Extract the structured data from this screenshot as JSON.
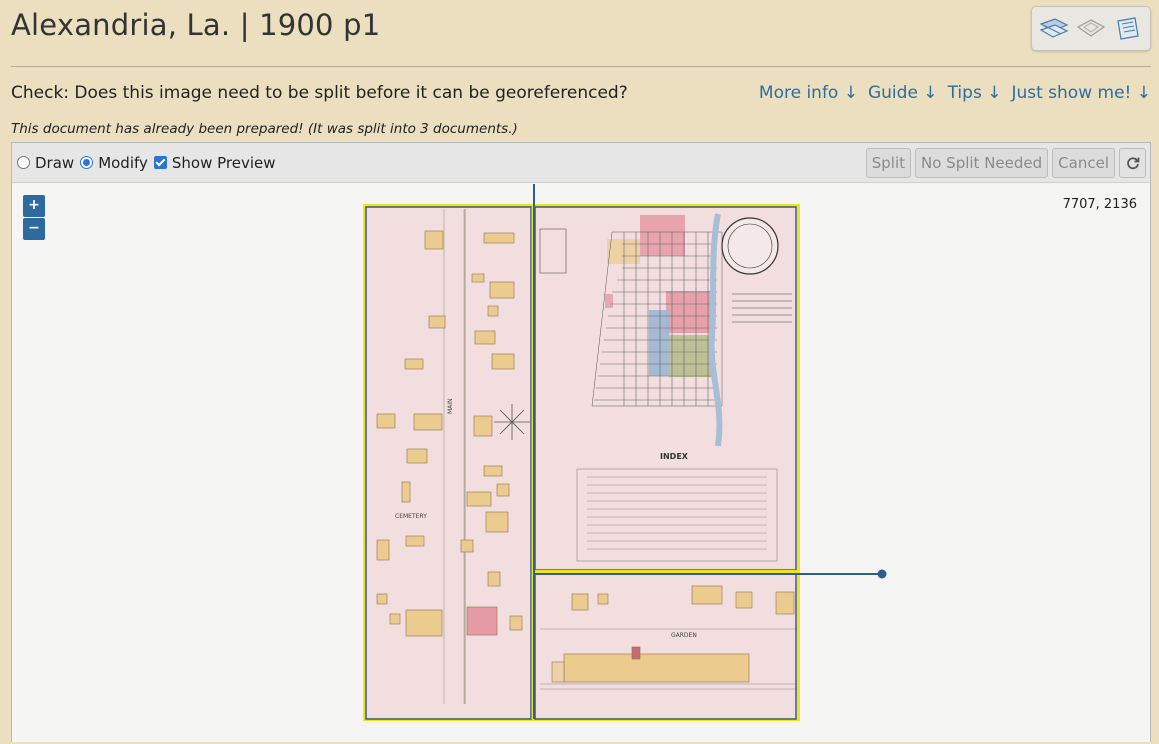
{
  "header": {
    "title": "Alexandria, La. | 1900 p1"
  },
  "toolbar_icons": [
    "split-map-icon",
    "georeference-map-icon",
    "mosaic-icon"
  ],
  "question": {
    "text": "Check: Does this image need to be split before it can be georeferenced?"
  },
  "links": [
    {
      "label": "More info ↓"
    },
    {
      "label": "Guide ↓"
    },
    {
      "label": "Tips ↓"
    },
    {
      "label": "Just show me! ↓"
    }
  ],
  "note": "This document has already been prepared! (It was split into 3 documents.)",
  "controls": {
    "draw_label": "Draw",
    "modify_label": "Modify",
    "preview_label": "Show Preview",
    "mode": "Modify",
    "show_preview": true,
    "split_label": "Split",
    "no_split_label": "No Split Needed",
    "cancel_label": "Cancel"
  },
  "map": {
    "coords": "7707, 2136",
    "zoom_in": "+",
    "zoom_out": "−",
    "labels": {
      "main_street": "MAIN",
      "cemetery": "CEMETERY",
      "index": "INDEX",
      "garden": "GARDEN"
    }
  },
  "colors": {
    "link": "#2b6da3",
    "split_line": "#2e5e8c",
    "preview_outline": "#f2e21a",
    "map_paper": "#f2dede",
    "building_yellow": "#eccb8f",
    "building_red": "#e59aa5",
    "building_blue": "#9fb6d2",
    "building_green": "#b8bd8e"
  }
}
